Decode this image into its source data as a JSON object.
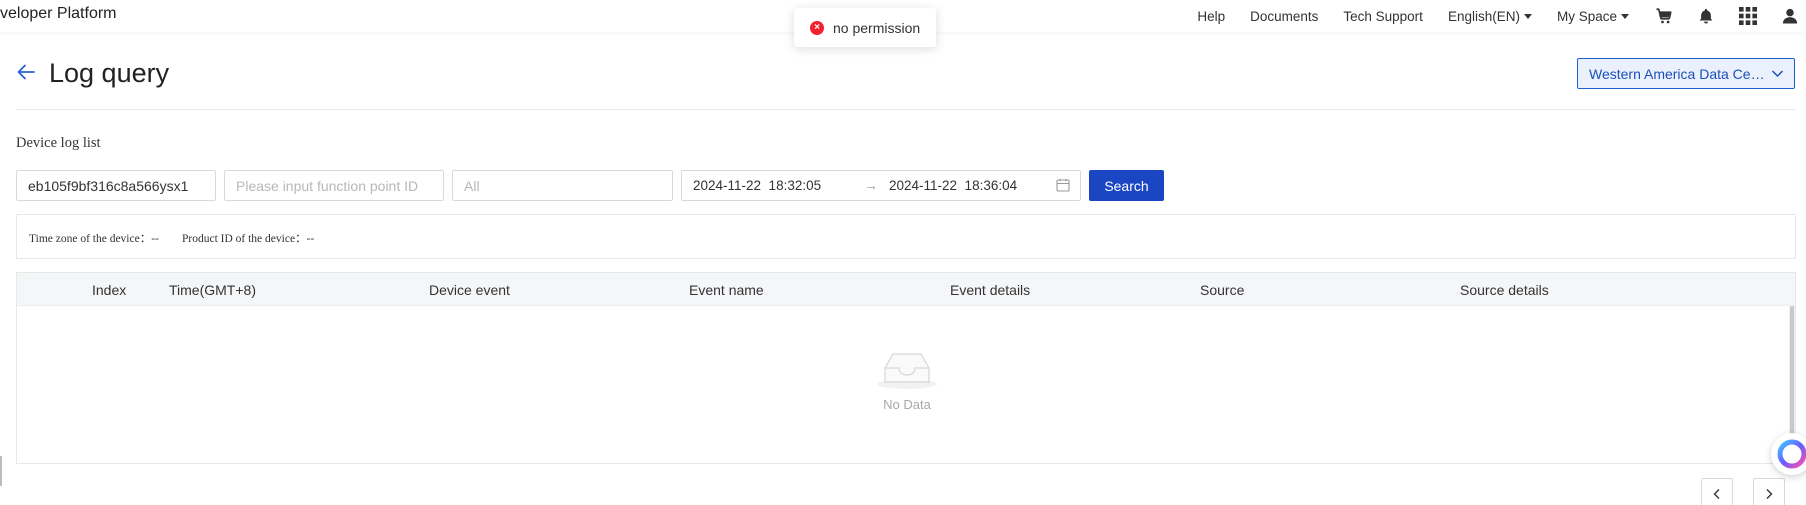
{
  "nav": {
    "brand": "veloper Platform",
    "links": [
      "Help",
      "Documents",
      "Tech Support",
      "English(EN)",
      "My Space"
    ]
  },
  "toast": {
    "message": "no permission",
    "icon": "close-icon",
    "color": "#f5222d"
  },
  "header": {
    "title": "Log query",
    "data_center": "Western America Data Center"
  },
  "filters": {
    "section_label": "Device log list",
    "device_id": "eb105f9bf316c8a566ysx1",
    "function_point_placeholder": "Please input function point ID",
    "event_type_placeholder": "All",
    "date_start": "2024-11-22  18:32:05",
    "date_sep": "→",
    "date_end": "2024-11-22  18:36:04",
    "search_label": "Search"
  },
  "info": {
    "timezone_label": "Time zone of the device：",
    "timezone_value": "--",
    "product_label": "Product ID of the device：",
    "product_value": "--"
  },
  "table": {
    "columns": [
      "Index",
      "Time(GMT+8)",
      "Device event",
      "Event name",
      "Event details",
      "Source",
      "Source details"
    ],
    "empty_text": "No Data"
  },
  "colors": {
    "primary": "#1a46c4",
    "accent": "#1d5fd1",
    "error": "#f5222d"
  }
}
